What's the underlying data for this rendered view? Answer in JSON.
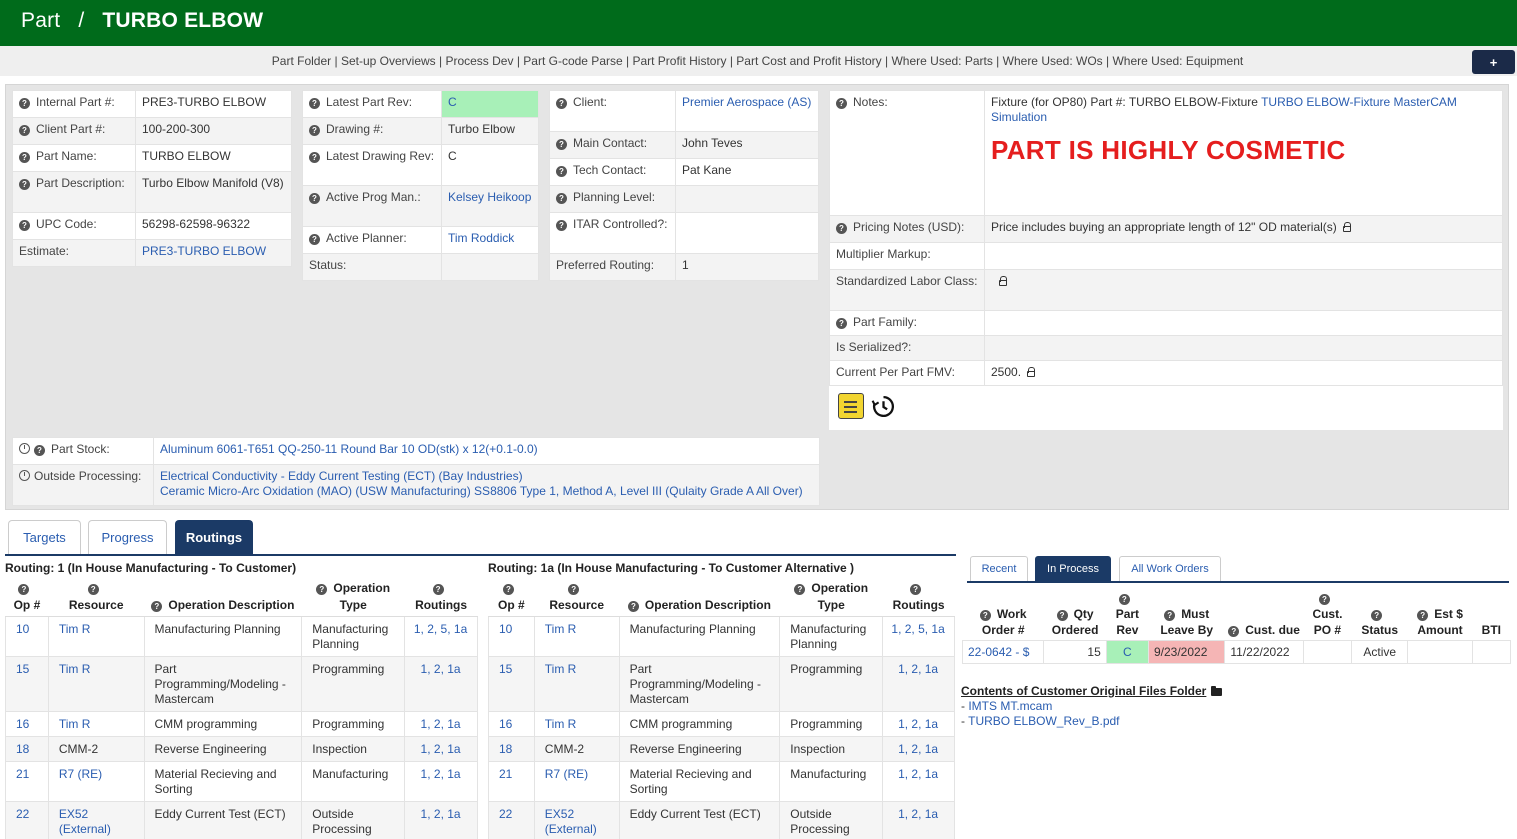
{
  "header": {
    "crumb_root": "Part",
    "separator": "/",
    "part_name": "TURBO ELBOW"
  },
  "nav": {
    "links": [
      "Part Folder",
      "Set-up Overviews",
      "Process Dev",
      "Part G-code Parse",
      "Part Profit History",
      "Part Cost and Profit History",
      "Where Used: Parts",
      "Where Used: WOs",
      "Where Used: Equipment"
    ],
    "plus_label": "+"
  },
  "part_info": {
    "internal_part_label": "Internal Part #:",
    "internal_part": "PRE3-TURBO ELBOW",
    "client_part_label": "Client Part #:",
    "client_part": "100-200-300",
    "part_name_label": "Part Name:",
    "part_name": "TURBO ELBOW",
    "part_desc_label": "Part Description:",
    "part_desc": "Turbo Elbow Manifold (V8)",
    "upc_label": "UPC Code:",
    "upc": "56298-62598-96322",
    "estimate_label": "Estimate:",
    "estimate": "PRE3-TURBO ELBOW"
  },
  "rev_info": {
    "latest_rev_label": "Latest Part Rev:",
    "latest_rev": "C",
    "drawing_label": "Drawing #:",
    "drawing": "Turbo Elbow",
    "drawing_rev_label": "Latest Drawing Rev:",
    "drawing_rev": "C",
    "prog_man_label": "Active Prog Man.:",
    "prog_man": "Kelsey Heikoop",
    "planner_label": "Active Planner:",
    "planner": "Tim Roddick",
    "status_label": "Status:",
    "status": ""
  },
  "client_info": {
    "client_label": "Client:",
    "client": "Premier Aerospace (AS)",
    "main_contact_label": "Main Contact:",
    "main_contact": "John Teves",
    "tech_contact_label": "Tech Contact:",
    "tech_contact": "Pat Kane",
    "planning_level_label": "Planning Level:",
    "planning_level": "",
    "itar_label": "ITAR Controlled?:",
    "itar": "",
    "pref_routing_label": "Preferred Routing:",
    "pref_routing": "1"
  },
  "notes": {
    "notes_label": "Notes:",
    "notes_text": "Fixture (for OP80) Part #: TURBO ELBOW-Fixture",
    "notes_link": "TURBO ELBOW-Fixture MasterCAM Simulation",
    "cosmetic": "PART IS HIGHLY COSMETIC",
    "pricing_label": "Pricing Notes (USD):",
    "pricing": "Price includes buying an appropriate length of 12\" OD material(s)",
    "multiplier_label": "Multiplier Markup:",
    "multiplier": "",
    "labor_label": "Standardized Labor Class:",
    "family_label": "Part Family:",
    "family": "",
    "serialized_label": "Is Serialized?:",
    "serialized": "",
    "fmv_label": "Current Per Part FMV:",
    "fmv": "2500."
  },
  "stock": {
    "stock_label": "Part Stock:",
    "stock": "Aluminum 6061-T651 QQ-250-11 Round Bar 10 OD(stk) x 12(+0.1-0.0)",
    "outside_label": "Outside Processing:",
    "outside_1": "Electrical Conductivity - Eddy Current Testing (ECT) (Bay Industries)",
    "outside_2": "Ceramic Micro-Arc Oxidation (MAO) (USW Manufacturing) SS8806 Type 1, Method A, Level III (Qulaity Grade A All Over)"
  },
  "tabs": [
    "Targets",
    "Progress",
    "Routings"
  ],
  "routing_headers": {
    "op": "Op #",
    "resource": "Resource",
    "desc": "Operation Description",
    "type": "Operation Type",
    "routings": "Routings"
  },
  "routing1": {
    "title": "Routing: 1 (In House Manufacturing - To Customer)",
    "rows": [
      {
        "op": "10",
        "resource": "Tim R",
        "desc": "Manufacturing Planning",
        "type": "Manufacturing Planning",
        "routings": "1, 2, 5, 1a"
      },
      {
        "op": "15",
        "resource": "Tim R",
        "desc": "Part Programming/Modeling - Mastercam",
        "type": "Programming",
        "routings": "1, 2, 1a"
      },
      {
        "op": "16",
        "resource": "Tim R",
        "desc": "CMM programming",
        "type": "Programming",
        "routings": "1, 2, 1a"
      },
      {
        "op": "18",
        "resource": "CMM-2",
        "desc": "Reverse Engineering",
        "type": "Inspection",
        "routings": "1, 2, 1a"
      },
      {
        "op": "21",
        "resource": "R7 (RE)",
        "desc": "Material Recieving and Sorting",
        "type": "Manufacturing",
        "routings": "1, 2, 1a"
      },
      {
        "op": "22",
        "resource": "EX52 (External)",
        "desc": "Eddy Current Test (ECT)",
        "type": "Outside Processing",
        "routings": "1, 2, 1a"
      }
    ]
  },
  "routing2": {
    "title": "Routing: 1a (In House Manufacturing - To Customer Alternative )",
    "rows": [
      {
        "op": "10",
        "resource": "Tim R",
        "desc": "Manufacturing Planning",
        "type": "Manufacturing Planning",
        "routings": "1, 2, 5, 1a"
      },
      {
        "op": "15",
        "resource": "Tim R",
        "desc": "Part Programming/Modeling - Mastercam",
        "type": "Programming",
        "routings": "1, 2, 1a"
      },
      {
        "op": "16",
        "resource": "Tim R",
        "desc": "CMM programming",
        "type": "Programming",
        "routings": "1, 2, 1a"
      },
      {
        "op": "18",
        "resource": "CMM-2",
        "desc": "Reverse Engineering",
        "type": "Inspection",
        "routings": "1, 2, 1a"
      },
      {
        "op": "21",
        "resource": "R7 (RE)",
        "desc": "Material Recieving and Sorting",
        "type": "Manufacturing",
        "routings": "1, 2, 1a"
      },
      {
        "op": "22",
        "resource": "EX52 (External)",
        "desc": "Eddy Current Test (ECT)",
        "type": "Outside Processing",
        "routings": "1, 2, 1a"
      }
    ]
  },
  "wo_tabs": [
    "Recent",
    "In Process",
    "All Work Orders"
  ],
  "wo_headers": {
    "wo": "Work Order #",
    "qty": "Qty Ordered",
    "rev": "Part Rev",
    "must": "Must Leave By",
    "due": "Cust. due",
    "po": "Cust. PO #",
    "status": "Status",
    "amount": "Est $ Amount",
    "bti": "BTI"
  },
  "wo_rows": [
    {
      "wo": "22-0642 - $",
      "qty": "15",
      "rev": "C",
      "must": "9/23/2022",
      "due": "11/22/2022",
      "po": "",
      "status": "Active",
      "amount": "",
      "bti": ""
    }
  ],
  "files": {
    "title": "Contents of Customer Original Files Folder",
    "prefix": "- ",
    "items": [
      "IMTS MT.mcam",
      "TURBO ELBOW_Rev_B.pdf"
    ]
  },
  "colors": {
    "header": "#006b1b",
    "accent": "#1b3a66",
    "link": "#2a5db0",
    "green": "#a8f0b8",
    "red": "#f5b5b5",
    "cosmetic": "#e51e1e"
  }
}
